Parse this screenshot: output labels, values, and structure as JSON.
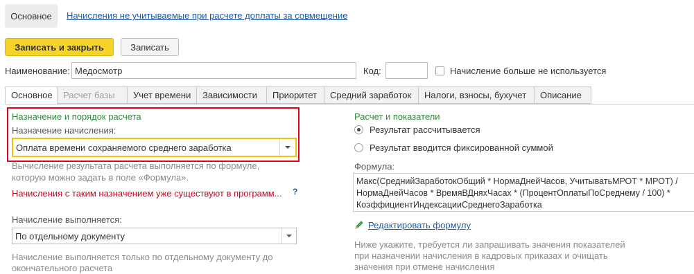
{
  "top_nav": {
    "active_tab": "Основное",
    "link": "Начисления не учитываемые при расчете доплаты за совмещение"
  },
  "toolbar": {
    "save_close_label": "Записать и закрыть",
    "save_label": "Записать"
  },
  "header": {
    "name_label": "Наименование:",
    "name_value": "Медосмотр",
    "code_label": "Код:",
    "code_value": "",
    "not_used_label": "Начисление больше не используется"
  },
  "tabs": [
    {
      "label": "Основное",
      "state": "active"
    },
    {
      "label": "Расчет базы",
      "state": "disabled"
    },
    {
      "label": "Учет времени",
      "state": "normal"
    },
    {
      "label": "Зависимости",
      "state": "normal"
    },
    {
      "label": "Приоритет",
      "state": "normal"
    },
    {
      "label": "Средний заработок",
      "state": "normal"
    },
    {
      "label": "Налоги, взносы, бухучет",
      "state": "normal"
    },
    {
      "label": "Описание",
      "state": "normal"
    }
  ],
  "left": {
    "section_title": "Назначение и порядок расчета",
    "purpose_label": "Назначение начисления:",
    "purpose_value": "Оплата времени сохраняемого среднего заработка",
    "formula_hint_line1": "Вычисление результата расчета выполняется по формуле,",
    "formula_hint_line2": "которую можно задать в поле «Формула».",
    "warning": "Начисления с таким назначением уже существуют в программ...",
    "help_mark": "?",
    "execution_label": "Начисление выполняется:",
    "execution_value": "По отдельному документу",
    "execution_hint_line1": "Начисление выполняется только по отдельному документу до",
    "execution_hint_line2": "окончательного расчета"
  },
  "right": {
    "section_title": "Расчет и показатели",
    "radio_calculated": "Результат рассчитывается",
    "radio_fixed": "Результат вводится фиксированной суммой",
    "formula_label": "Формула:",
    "formula_line1": "Макс(СреднийЗаработокОбщий * НормаДнейЧасов, УчитыватьМРОТ * МРОТ) /",
    "formula_line2": "НормаДнейЧасов * ВремяВДняхЧасах * (ПроцентОплатыПоСреднему / 100) *",
    "formula_line3": "КоэффициентИндексацииСреднегоЗаработка",
    "edit_formula_link": "Редактировать формулу",
    "hint_line1": "Ниже укажите, требуется ли запрашивать значения показателей",
    "hint_line2": "при назначении начисления в кадровых приказах и очищать",
    "hint_line3": "значения при отмене начисления"
  },
  "colors": {
    "accent_yellow": "#f7d42a",
    "section_green": "#2e8b3a",
    "warning_red": "#d0021b",
    "link_blue": "#1a5aa8",
    "highlight_red": "#e3001b",
    "focus_yellow": "#f2c200"
  }
}
